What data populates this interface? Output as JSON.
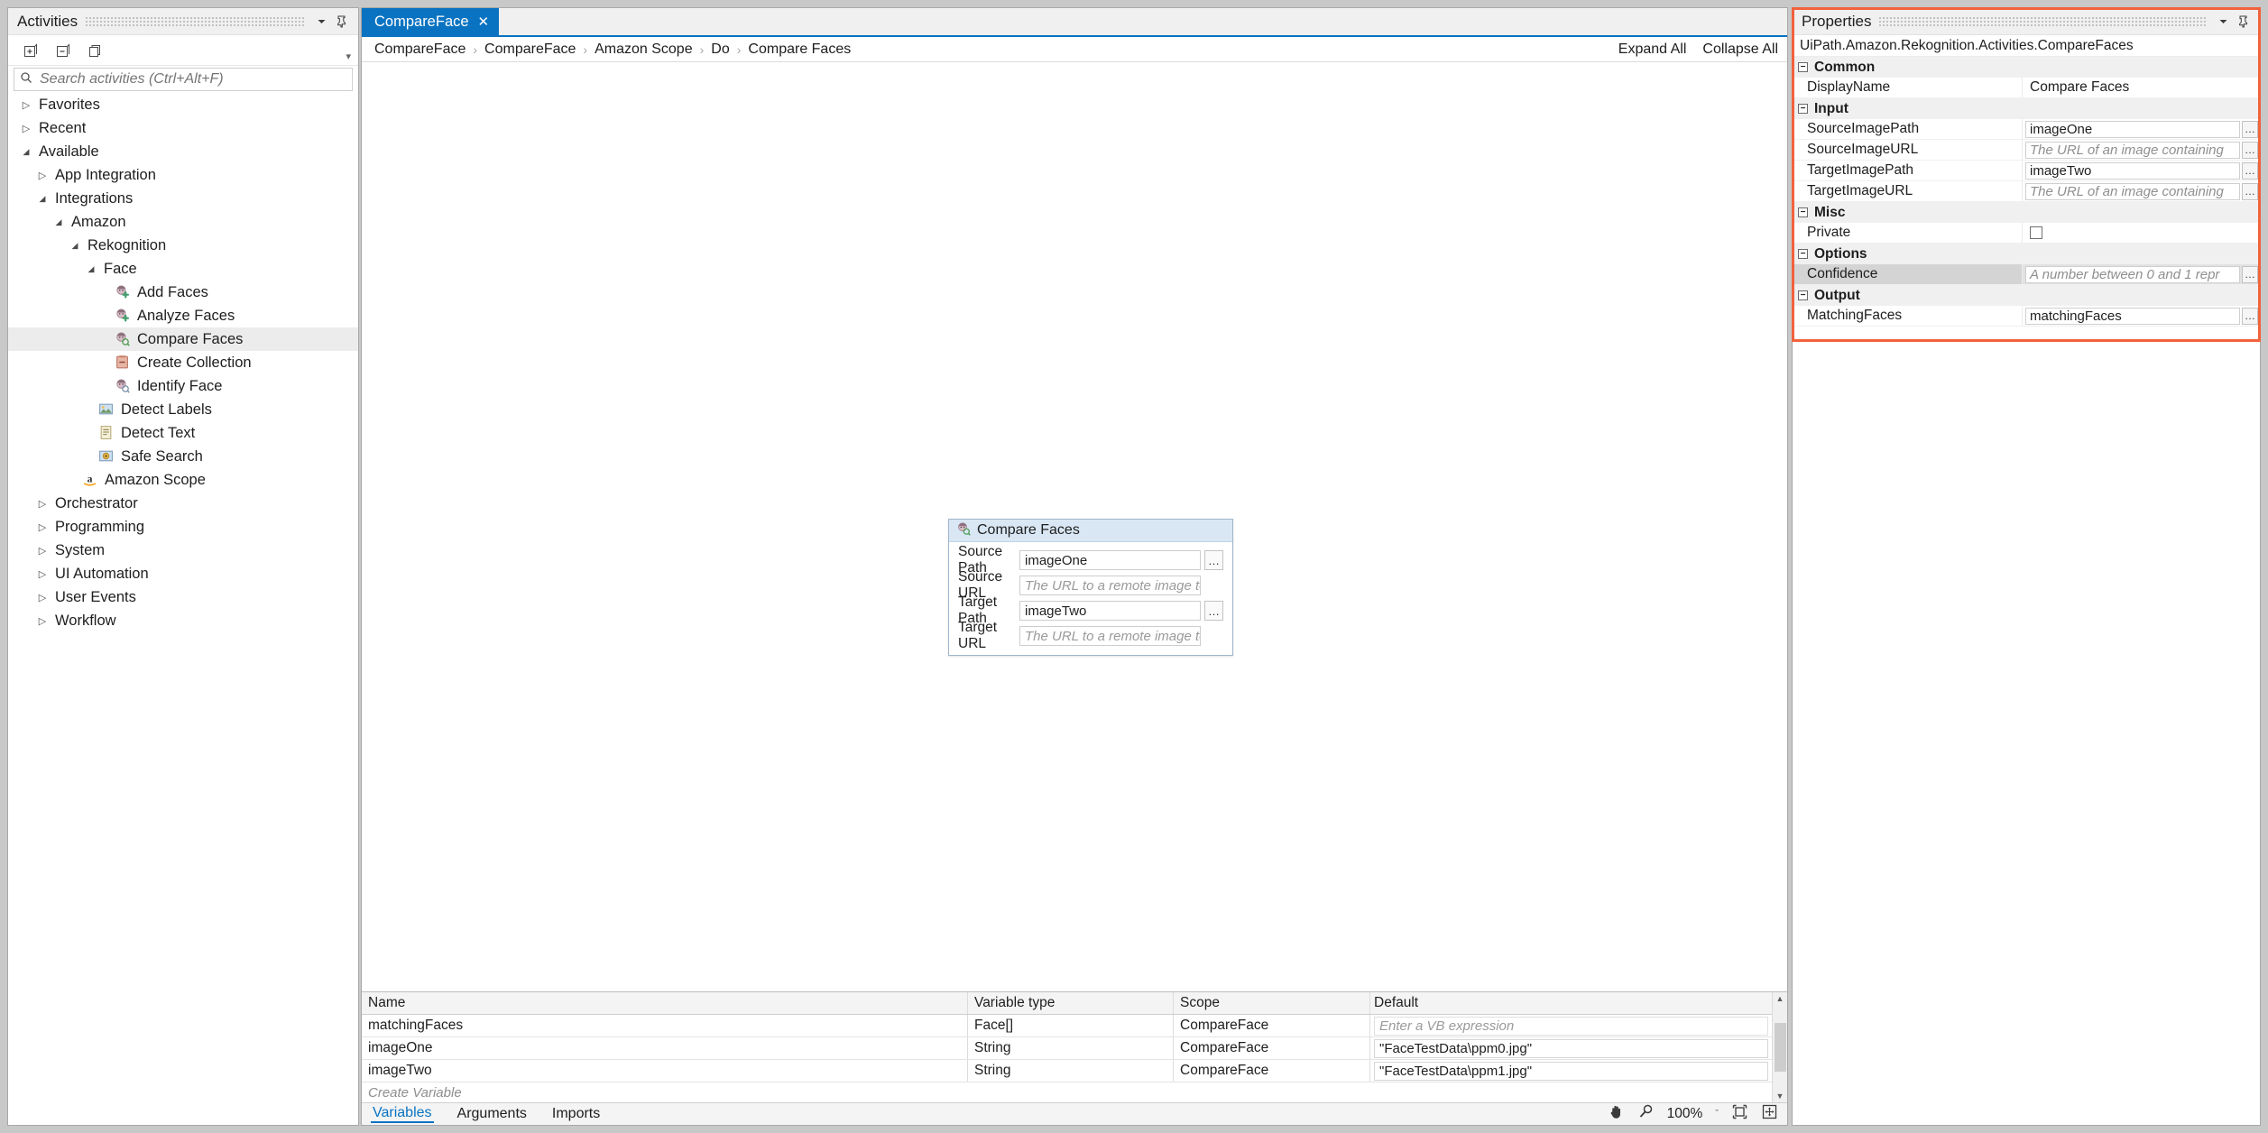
{
  "activities": {
    "title": "Activities",
    "search_placeholder": "Search activities (Ctrl+Alt+F)",
    "toolbar": {
      "expand_all": "expand-all-icon",
      "collapse_all": "collapse-all-icon",
      "show_classic": "copy-icon"
    },
    "tree": [
      {
        "label": "Favorites",
        "depth": 0,
        "state": "collapsed",
        "icon": ""
      },
      {
        "label": "Recent",
        "depth": 0,
        "state": "collapsed",
        "icon": ""
      },
      {
        "label": "Available",
        "depth": 0,
        "state": "expanded",
        "icon": ""
      },
      {
        "label": "App Integration",
        "depth": 1,
        "state": "collapsed",
        "icon": ""
      },
      {
        "label": "Integrations",
        "depth": 1,
        "state": "expanded",
        "icon": ""
      },
      {
        "label": "Amazon",
        "depth": 2,
        "state": "expanded",
        "icon": ""
      },
      {
        "label": "Rekognition",
        "depth": 3,
        "state": "expanded",
        "icon": ""
      },
      {
        "label": "Face",
        "depth": 4,
        "state": "expanded",
        "icon": ""
      },
      {
        "label": "Add Faces",
        "depth": 5,
        "state": "leaf",
        "icon": "face-add-icon"
      },
      {
        "label": "Analyze Faces",
        "depth": 5,
        "state": "leaf",
        "icon": "face-analyze-icon"
      },
      {
        "label": "Compare Faces",
        "depth": 5,
        "state": "leaf",
        "icon": "face-compare-icon",
        "selected": true
      },
      {
        "label": "Create Collection",
        "depth": 5,
        "state": "leaf",
        "icon": "collection-icon"
      },
      {
        "label": "Identify Face",
        "depth": 5,
        "state": "leaf",
        "icon": "face-identify-icon"
      },
      {
        "label": "Detect Labels",
        "depth": 4,
        "state": "leaf",
        "icon": "image-label-icon"
      },
      {
        "label": "Detect Text",
        "depth": 4,
        "state": "leaf",
        "icon": "text-doc-icon"
      },
      {
        "label": "Safe Search",
        "depth": 4,
        "state": "leaf",
        "icon": "safe-search-icon"
      },
      {
        "label": "Amazon Scope",
        "depth": 3,
        "state": "leaf",
        "icon": "amazon-icon"
      },
      {
        "label": "Orchestrator",
        "depth": 1,
        "state": "collapsed",
        "icon": ""
      },
      {
        "label": "Programming",
        "depth": 1,
        "state": "collapsed",
        "icon": ""
      },
      {
        "label": "System",
        "depth": 1,
        "state": "collapsed",
        "icon": ""
      },
      {
        "label": "UI Automation",
        "depth": 1,
        "state": "collapsed",
        "icon": ""
      },
      {
        "label": "User Events",
        "depth": 1,
        "state": "collapsed",
        "icon": ""
      },
      {
        "label": "Workflow",
        "depth": 1,
        "state": "collapsed",
        "icon": ""
      }
    ]
  },
  "designer": {
    "tab": {
      "label": "CompareFace",
      "close": "✕"
    },
    "breadcrumb": [
      "CompareFace",
      "CompareFace",
      "Amazon Scope",
      "Do",
      "Compare Faces"
    ],
    "expand_all": "Expand All",
    "collapse_all": "Collapse All",
    "activity_card": {
      "title": "Compare Faces",
      "icon": "face-compare-icon",
      "fields": [
        {
          "label": "Source Path",
          "value": "imageOne",
          "placeholder": "",
          "has_ellipsis": true
        },
        {
          "label": "Source URL",
          "value": "",
          "placeholder": "The URL to a remote image to be analyse",
          "has_ellipsis": false
        },
        {
          "label": "Target Path",
          "value": "imageTwo",
          "placeholder": "",
          "has_ellipsis": true
        },
        {
          "label": "Target URL",
          "value": "",
          "placeholder": "The URL to a remote image to be analyse",
          "has_ellipsis": false
        }
      ]
    }
  },
  "variables": {
    "headers": [
      "Name",
      "Variable type",
      "Scope",
      "Default"
    ],
    "rows": [
      {
        "name": "matchingFaces",
        "type": "Face[]",
        "scope": "CompareFace",
        "default": "",
        "default_placeholder": "Enter a VB expression"
      },
      {
        "name": "imageOne",
        "type": "String",
        "scope": "CompareFace",
        "default": "\"FaceTestData\\ppm0.jpg\"",
        "default_placeholder": ""
      },
      {
        "name": "imageTwo",
        "type": "String",
        "scope": "CompareFace",
        "default": "\"FaceTestData\\ppm1.jpg\"",
        "default_placeholder": ""
      }
    ],
    "create_variable": "Create Variable",
    "tabs": [
      {
        "label": "Variables",
        "active": true
      },
      {
        "label": "Arguments",
        "active": false
      },
      {
        "label": "Imports",
        "active": false
      }
    ],
    "status": {
      "pan": "hand-pan-icon",
      "zoom_tool": "magnifier-icon",
      "zoom_level": "100%",
      "zoom_caret": "ˇ",
      "fit_to_screen": "fit-to-screen-icon",
      "overview": "overview-icon"
    }
  },
  "properties": {
    "title": "Properties",
    "type_name": "UiPath.Amazon.Rekognition.Activities.CompareFaces",
    "groups": [
      {
        "name": "Common",
        "rows": [
          {
            "name": "DisplayName",
            "value": "Compare Faces",
            "kind": "plain"
          }
        ]
      },
      {
        "name": "Input",
        "rows": [
          {
            "name": "SourceImagePath",
            "value": "imageOne",
            "placeholder": "",
            "kind": "box"
          },
          {
            "name": "SourceImageURL",
            "value": "",
            "placeholder": "The URL of an image containing",
            "kind": "box"
          },
          {
            "name": "TargetImagePath",
            "value": "imageTwo",
            "placeholder": "",
            "kind": "box"
          },
          {
            "name": "TargetImageURL",
            "value": "",
            "placeholder": "The URL of an image containing",
            "kind": "box"
          }
        ]
      },
      {
        "name": "Misc",
        "rows": [
          {
            "name": "Private",
            "value": "",
            "kind": "checkbox"
          }
        ]
      },
      {
        "name": "Options",
        "rows": [
          {
            "name": "Confidence",
            "value": "",
            "placeholder": "A number between 0 and 1 repr",
            "kind": "box",
            "dim": true
          }
        ]
      },
      {
        "name": "Output",
        "rows": [
          {
            "name": "MatchingFaces",
            "value": "matchingFaces",
            "placeholder": "",
            "kind": "box"
          }
        ]
      }
    ]
  },
  "colors": {
    "accent": "#0a73c1",
    "highlight": "#f2623c",
    "card_header": "#d9e7f5"
  }
}
